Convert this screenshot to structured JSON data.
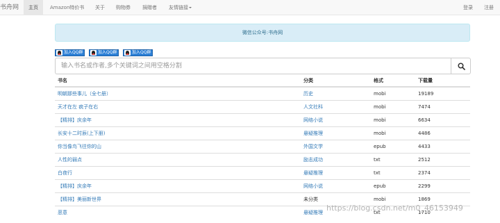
{
  "navbar": {
    "brand": "书舟网",
    "items": [
      {
        "label": "主页",
        "active": true
      },
      {
        "label": "Amazon特价书"
      },
      {
        "label": "关于"
      },
      {
        "label": "购物券"
      },
      {
        "label": "捐赠者"
      },
      {
        "label": "友情链接"
      }
    ],
    "login": "登录",
    "register": "注册"
  },
  "alert": {
    "text": "微信公众号:书舟网"
  },
  "qq_buttons": [
    "加入QQ群",
    "加入QQ群",
    "加入QQ群"
  ],
  "search": {
    "placeholder": "输入书名或作者,多个关键词之间用空格分割"
  },
  "table": {
    "headers": [
      "书名",
      "分类",
      "格式",
      "下载量"
    ],
    "rows": [
      {
        "title": "明朝那些事儿（全七册）",
        "category": "历史",
        "format": "mobi",
        "downloads": "19189"
      },
      {
        "title": "天才在左 疯子在右",
        "category": "人文社科",
        "format": "mobi",
        "downloads": "7474"
      },
      {
        "title": "【精排】庆余年",
        "category": "网络小说",
        "format": "mobi",
        "downloads": "6634"
      },
      {
        "title": "长安十二时辰(上下册)",
        "category": "悬疑推理",
        "format": "mobi",
        "downloads": "4486"
      },
      {
        "title": "你当像鸟飞往你的山",
        "category": "外国文学",
        "format": "epub",
        "downloads": "4433"
      },
      {
        "title": "人性的弱点",
        "category": "励志成功",
        "format": "txt",
        "downloads": "2512"
      },
      {
        "title": "白夜行",
        "category": "悬疑推理",
        "format": "txt",
        "downloads": "2374"
      },
      {
        "title": "【精排】庆余年",
        "category": "网络小说",
        "format": "epub",
        "downloads": "2299"
      },
      {
        "title": "【精排】美丽新世界",
        "category": "未分类",
        "format": "mobi",
        "downloads": "1869",
        "plain_category": true
      },
      {
        "title": "恶意",
        "category": "悬疑推理",
        "format": "txt",
        "downloads": "1710"
      }
    ]
  },
  "watermark": "https://blog.csdn.net/m0_46153949"
}
